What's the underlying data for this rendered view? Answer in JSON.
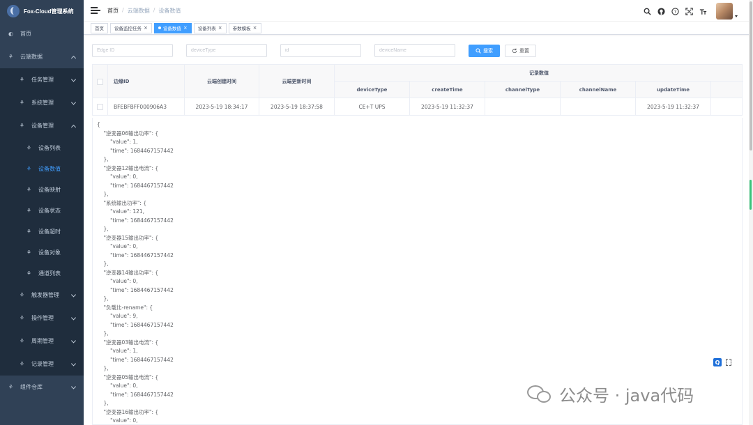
{
  "app": {
    "title": "Fox-Cloud管理系统"
  },
  "sidebar": {
    "items": [
      {
        "label": "首页",
        "icon": "dashboard-icon",
        "kind": "top"
      },
      {
        "label": "云端数据",
        "icon": "cloud-data-icon",
        "kind": "top",
        "expanded": true
      },
      {
        "label": "任务管理",
        "icon": "menu-icon",
        "kind": "sub"
      },
      {
        "label": "系统管理",
        "icon": "menu-icon",
        "kind": "sub"
      },
      {
        "label": "设备管理",
        "icon": "menu-icon",
        "kind": "sub",
        "expanded": true
      },
      {
        "label": "设备列表",
        "icon": "menu-icon",
        "kind": "leaf"
      },
      {
        "label": "设备数值",
        "icon": "menu-icon",
        "kind": "leaf",
        "active": true
      },
      {
        "label": "设备映射",
        "icon": "menu-icon",
        "kind": "leaf"
      },
      {
        "label": "设备状态",
        "icon": "menu-icon",
        "kind": "leaf"
      },
      {
        "label": "设备超时",
        "icon": "menu-icon",
        "kind": "leaf"
      },
      {
        "label": "设备对象",
        "icon": "menu-icon",
        "kind": "leaf"
      },
      {
        "label": "通道列表",
        "icon": "menu-icon",
        "kind": "leaf"
      },
      {
        "label": "触发器管理",
        "icon": "menu-icon",
        "kind": "sub"
      },
      {
        "label": "操作管理",
        "icon": "menu-icon",
        "kind": "sub"
      },
      {
        "label": "周期管理",
        "icon": "menu-icon",
        "kind": "sub"
      },
      {
        "label": "记录管理",
        "icon": "menu-icon",
        "kind": "sub"
      },
      {
        "label": "组件仓库",
        "icon": "menu-icon",
        "kind": "top"
      }
    ]
  },
  "breadcrumb": [
    "首页",
    "云端数据",
    "设备数值"
  ],
  "tags": [
    {
      "label": "首页",
      "active": false,
      "closable": false
    },
    {
      "label": "设备监控任务",
      "active": false,
      "closable": true
    },
    {
      "label": "设备数值",
      "active": true,
      "closable": true
    },
    {
      "label": "设备列表",
      "active": false,
      "closable": true
    },
    {
      "label": "参数模板",
      "active": false,
      "closable": true
    }
  ],
  "search": {
    "edge_id_placeholder": "Edge ID",
    "device_type_placeholder": "deviceType",
    "id_placeholder": "id",
    "device_name_placeholder": "deviceName",
    "search_label": "搜索",
    "reset_label": "重置"
  },
  "table": {
    "headers": {
      "edge_id": "边缘ID",
      "create_time": "云端创建时间",
      "update_time": "云端更新时间",
      "record_values": "记录数值",
      "device_type": "deviceType",
      "record_create_time": "createTime",
      "channel_type": "channelType",
      "channel_name": "channelName",
      "record_update_time": "updateTime"
    },
    "row": {
      "edge_id": "BFEBFBFF000906A3",
      "create_time": "2023-5-19 18:34:17",
      "update_time": "2023-5-19 18:37:58",
      "device_type": "CE+T UPS",
      "record_create_time": "2023-5-19 11:32:37",
      "channel_type": "",
      "channel_name": "",
      "record_update_time": "2023-5-19 11:32:37"
    }
  },
  "json_text": "{\n    \"逆变器06输出功率\": {\n        \"value\": 1,\n        \"time\": 1684467157442\n    },\n    \"逆变器12输出电流\": {\n        \"value\": 0,\n        \"time\": 1684467157442\n    },\n    \"系统输出功率\": {\n        \"value\": 121,\n        \"time\": 1684467157442\n    },\n    \"逆变器15输出功率\": {\n        \"value\": 0,\n        \"time\": 1684467157442\n    },\n    \"逆变器14输出功率\": {\n        \"value\": 0,\n        \"time\": 1684467157442\n    },\n    \"负载比-rename\": {\n        \"value\": 9,\n        \"time\": 1684467157442\n    },\n    \"逆变器03输出电流\": {\n        \"value\": 1,\n        \"time\": 1684467157442\n    },\n    \"逆变器05输出电流\": {\n        \"value\": 0,\n        \"time\": 1684467157442\n    },\n    \"逆变器16输出功率\": {\n        \"value\": 0,",
  "watermark": {
    "text": "公众号 · java代码"
  },
  "colors": {
    "sidebar_bg": "#304156",
    "accent": "#409eff",
    "submenu_bg": "#1f2d3d"
  }
}
